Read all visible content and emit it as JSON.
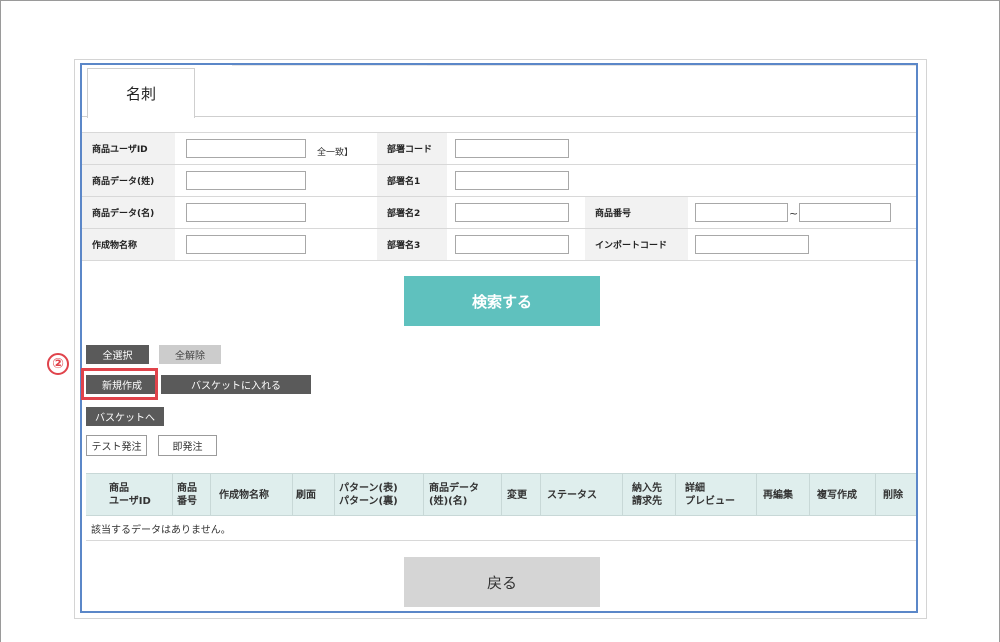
{
  "tab": {
    "label": "名刺"
  },
  "form": {
    "user_id_label": "商品ユーザID",
    "match_hint": "全一致】",
    "data_sei_label": "商品データ(姓)",
    "data_mei_label": "商品データ(名)",
    "product_name_label": "作成物名称",
    "dept_code_label": "部署コード",
    "dept1_label": "部署名1",
    "dept2_label": "部署名2",
    "dept3_label": "部署名3",
    "product_no_label": "商品番号",
    "range_sep": "~",
    "import_code_label": "インポートコード"
  },
  "buttons": {
    "search": "検索する",
    "select_all": "全選択",
    "deselect_all": "全解除",
    "new_create": "新規作成",
    "add_basket": "バスケットに入れる",
    "to_basket": "バスケットへ",
    "test_order": "テスト発注",
    "instant_order": "即発注",
    "back": "戻る"
  },
  "annotation": {
    "step": "②"
  },
  "table": {
    "columns": [
      "商品\nユーザID",
      "商品\n番号",
      "作成物名称",
      "刷面",
      "パターン(表)\nパターン(裏)",
      "商品データ\n(姓)(名)",
      "変更",
      "ステータス",
      "納入先\n請求先",
      "詳細\nプレビュー",
      "再編集",
      "複写作成",
      "削除"
    ],
    "empty_message": "該当するデータはありません。"
  },
  "colors": {
    "panel_border": "#5b87c8",
    "search_button": "#5fc1be",
    "table_header": "#dfeeed",
    "highlight": "#e0434b"
  }
}
